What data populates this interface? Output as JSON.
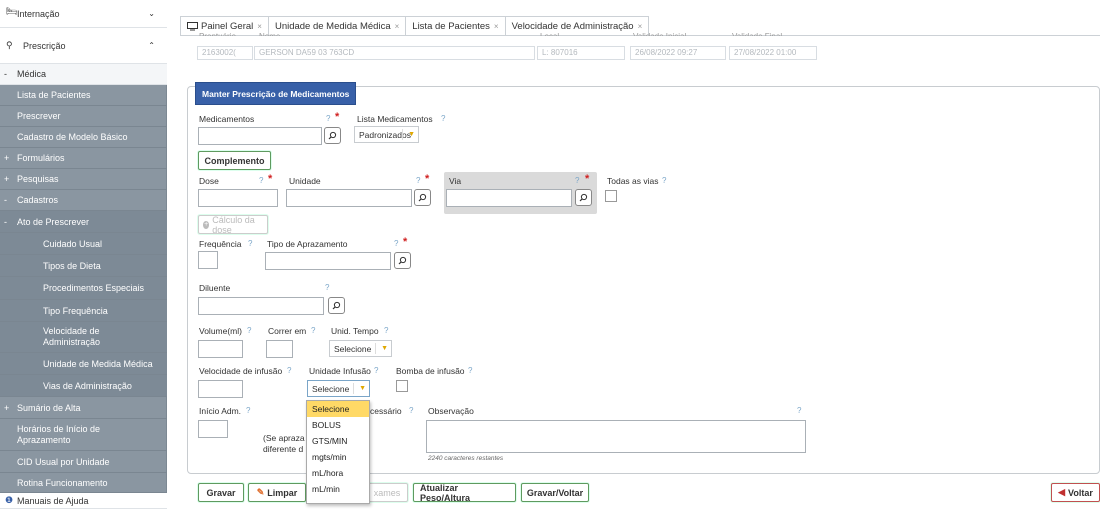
{
  "sidebar": {
    "items": [
      {
        "label": "Internação",
        "prefix": "🛏",
        "chevron": "⌄"
      },
      {
        "label": "Prescrição",
        "prefix": "⚲",
        "chevron": "⌃"
      },
      {
        "label": "Médica",
        "prefix": "-"
      },
      {
        "label": "Lista de Pacientes"
      },
      {
        "label": "Prescrever"
      },
      {
        "label": "Cadastro de Modelo Básico"
      },
      {
        "label": "Formulários",
        "prefix": "+"
      },
      {
        "label": "Pesquisas",
        "prefix": "+"
      },
      {
        "label": "Cadastros",
        "prefix": "-"
      },
      {
        "label": "Ato de Prescrever",
        "prefix": "-"
      },
      {
        "label": "Cuidado Usual"
      },
      {
        "label": "Tipos de Dieta"
      },
      {
        "label": "Procedimentos Especiais"
      },
      {
        "label": "Tipo Frequência"
      },
      {
        "label": "Velocidade de Administração"
      },
      {
        "label": "Unidade de Medida Médica"
      },
      {
        "label": "Vias de Administração"
      },
      {
        "label": "Sumário de Alta",
        "prefix": "+"
      },
      {
        "label": "Horários de Início de Aprazamento"
      },
      {
        "label": "CID Usual por Unidade"
      },
      {
        "label": "Rotina Funcionamento"
      },
      {
        "label": "Manuais de Ajuda",
        "prefix": "❶"
      }
    ]
  },
  "tabs": [
    {
      "label": "Painel Geral",
      "icon": "monitor-icon"
    },
    {
      "label": "Unidade de Medida Médica"
    },
    {
      "label": "Lista de Pacientes"
    },
    {
      "label": "Velocidade de Administração"
    }
  ],
  "tab_close": "×",
  "header": {
    "labels": {
      "prontuario": "Prontuário",
      "nome": "Nome",
      "local": "Local",
      "validade_inicial": "Validade Inicial",
      "validade_final": "Validade Final"
    },
    "prontuario": "2163002(",
    "nome": "GERSON DA59 03 763CD",
    "local": "L: 807016",
    "validade_inicial": "26/08/2022 09:27",
    "validade_final": "27/08/2022 01:00"
  },
  "form": {
    "legend": "Manter Prescrição de Medicamentos",
    "q": "?",
    "req": "*",
    "medicamentos": "Medicamentos",
    "lista_medicamentos": "Lista Medicamentos",
    "lista_value": "Padronizados",
    "complemento": "Complemento",
    "dose": "Dose",
    "unidade": "Unidade",
    "via": "Via",
    "todas_vias": "Todas as vias",
    "calculo_dose": "Cálculo da dose",
    "frequencia": "Frequência",
    "tipo_aprazamento": "Tipo de Aprazamento",
    "diluente": "Diluente",
    "volume": "Volume(ml)",
    "correr_em": "Correr em",
    "unid_tempo": "Unid. Tempo",
    "unid_tempo_value": "Selecione",
    "velocidade_infusao": "Velocidade de infusão",
    "unidade_infusao": "Unidade Infusão",
    "unidade_infusao_value": "Selecione",
    "bomba_infusao": "Bomba de infusão",
    "inicio_adm": "Início Adm.",
    "se_necessario": "cessário",
    "observacao": "Observação",
    "se_aprazar": "(Se apraza",
    "diferente": "diferente d",
    "caracteres": "2240 caracteres restantes"
  },
  "dropdown": {
    "options": [
      "Selecione",
      "BOLUS",
      "GTS/MIN",
      "mgts/min",
      "mL/hora",
      "mL/min"
    ]
  },
  "buttons": {
    "gravar": "Gravar",
    "limpar": "Limpar",
    "exames": "xames",
    "atualizar": "Atualizar Peso/Altura",
    "gravar_voltar": "Gravar/Voltar",
    "voltar": "Voltar"
  }
}
